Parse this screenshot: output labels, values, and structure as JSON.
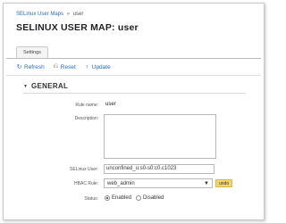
{
  "breadcrumb": {
    "parent": "SELinux User Maps",
    "separator": "»",
    "current": "user"
  },
  "page": {
    "title": "SELINUX USER MAP: user"
  },
  "tabs": [
    {
      "label": "Settings",
      "active": true
    }
  ],
  "toolbar": {
    "refresh_label": "Refresh",
    "reset_label": "Reset",
    "update_label": "Update"
  },
  "section": {
    "title": "GENERAL",
    "expanded": true
  },
  "form": {
    "rule_name_label": "Rule name:",
    "rule_name_value": "user",
    "description_label": "Description:",
    "description_value": "",
    "selinux_user_label": "SELinux User:",
    "selinux_user_value": "unconfined_u:s0-s0:c0.c1023",
    "hbac_rule_label": "HBAC Rule:",
    "hbac_rule_value": "web_admin",
    "undo_label": "undo",
    "status_label": "Status:",
    "status_options": [
      "Enabled",
      "Disabled"
    ],
    "status_selected": "Enabled"
  },
  "colors": {
    "link": "#2a6bb5",
    "undo_bg": "#f3d66b"
  }
}
